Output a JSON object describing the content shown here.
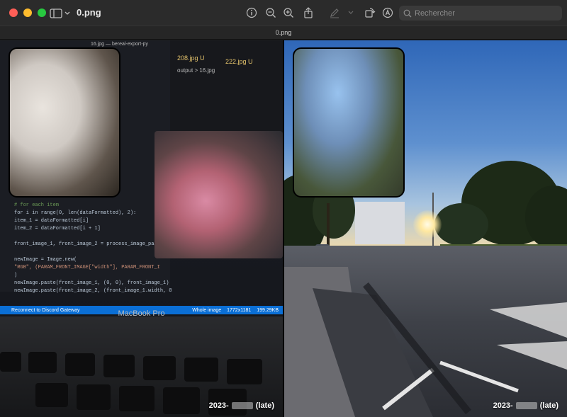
{
  "window": {
    "title": "0.png",
    "tab_label": "0.png"
  },
  "toolbar": {
    "search_placeholder": "Rechercher",
    "icons": [
      "sidebar-icon",
      "chevron-down-icon",
      "info-icon",
      "zoom-out-icon",
      "zoom-in-icon",
      "share-icon",
      "markup-pen-icon",
      "chevron-down-icon",
      "rotate-icon",
      "annotate-icon",
      "search-icon"
    ]
  },
  "left_photo": {
    "editor_title": "16.jpg — bereal-export-py",
    "tab_1": "208.jpg U",
    "tab_2": "222.jpg U",
    "breadcrumb": "output > 16.jpg",
    "status_bar_left": "Reconnect to Discord Gateway",
    "status_bar_right_1": "Whole image",
    "status_bar_right_2": "1772x1181",
    "status_bar_right_3": "199.29KB",
    "code_lines": [
      "# for each item",
      "for i in range(0, len(dataFormatted), 2):",
      "    item_1 = dataFormatted[i]",
      "    item_2 = dataFormatted[i + 1]",
      "",
      "    front_image_1, front_image_2 = process_image_pair(ite",
      "",
      "    newImage = Image.new(",
      "        \"RGB\", (PARAM_FRONT_IMAGE[\"width\"], PARAM_FRONT_I",
      "    )",
      "    newImage.paste(front_image_1, (0, 0), front_image_1)",
      "    newImage.paste(front_image_2, (front_image_1.width, 0"
    ],
    "laptop_label": "MacBook Pro",
    "caption_prefix": "2023-",
    "caption_suffix": "(late)"
  },
  "right_photo": {
    "caption_prefix": "2023-",
    "caption_suffix": "(late)"
  },
  "colors": {
    "close": "#ff5f57",
    "minimize": "#febc2e",
    "maximize": "#28c840",
    "vscode_status": "#0b6fd6"
  }
}
